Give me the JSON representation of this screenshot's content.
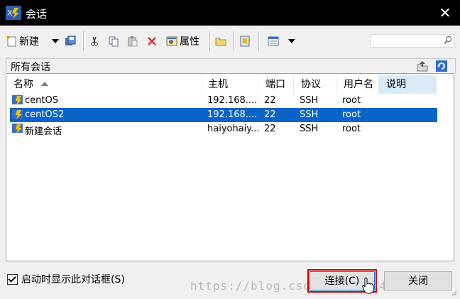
{
  "window": {
    "title": "会话",
    "close_glyph": "✕"
  },
  "toolbar": {
    "new_label": "新建",
    "properties_label": "属性"
  },
  "search": {
    "placeholder": "",
    "icon": "search-icon"
  },
  "path": {
    "label": "所有会话"
  },
  "table": {
    "columns": [
      "名称",
      "主机",
      "端口",
      "协议",
      "用户名",
      "说明"
    ],
    "sorted_column": "名称",
    "rows": [
      {
        "name": "centOS",
        "host": "192.168....",
        "port": "22",
        "protocol": "SSH",
        "user": "root",
        "desc": "",
        "selected": false
      },
      {
        "name": "centOS2",
        "host": "192.168....",
        "port": "22",
        "protocol": "SSH",
        "user": "root",
        "desc": "",
        "selected": true
      },
      {
        "name": "新建会话",
        "host": "haiyohaiy...",
        "port": "22",
        "protocol": "SSH",
        "user": "root",
        "desc": "",
        "selected": false
      }
    ]
  },
  "footer": {
    "startup_checkbox_label": "启动时显示此对话框(S)",
    "startup_checked": true,
    "connect_label": "连接(C)",
    "close_label": "关闭",
    "watermark": "https://blog.csdn.net/qq_42 6606"
  },
  "colors": {
    "selection": "#0a64c8",
    "titlebar": "#000000",
    "highlight_box": "#d00000"
  }
}
